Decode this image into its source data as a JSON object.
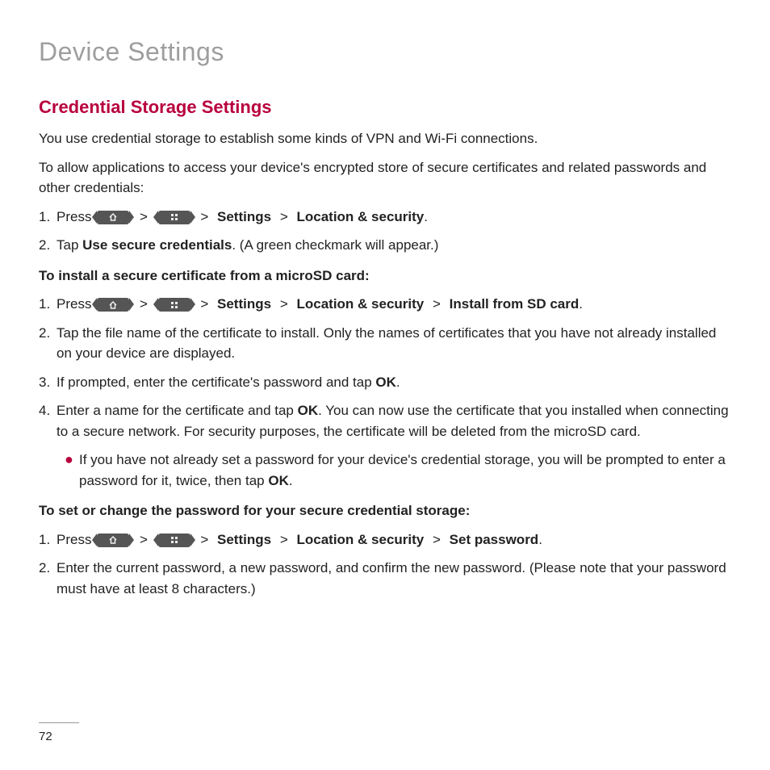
{
  "page_title": "Device Settings",
  "section_title": "Credential Storage Settings",
  "intro1": "You use credential storage to establish some kinds of VPN and Wi-Fi connections.",
  "intro2": "To allow applications to access your device's encrypted store of secure certificates and related passwords and other credentials:",
  "nav": {
    "settings": "Settings",
    "loc_sec": "Location & security",
    "install_sd": "Install from SD card",
    "set_pw": "Set password",
    "gt": ">"
  },
  "step1": {
    "num": "1.",
    "press": "Press",
    "end": "."
  },
  "step2": {
    "num": "2.",
    "pre": "Tap ",
    "bold": "Use secure credentials",
    "post": ". (A green checkmark will appear.)"
  },
  "subA": "To install a secure certificate from a microSD card:",
  "stepA1": {
    "num": "1.",
    "press": "Press",
    "end": "."
  },
  "stepA2": {
    "num": "2.",
    "text": "Tap the file name of the certificate to install. Only the names of certificates that you have not already installed on your device are displayed."
  },
  "stepA3": {
    "num": "3.",
    "pre": "If prompted, enter the certificate's password and tap ",
    "ok": "OK",
    "post": "."
  },
  "stepA4": {
    "num": "4.",
    "pre": "Enter a name for the certificate and tap ",
    "ok": "OK",
    "post": ". You can now use the certificate that you installed when connecting to a secure network. For security purposes, the certificate will be deleted from the microSD card."
  },
  "bulletA": {
    "pre": "If you have not already set a password for your device's credential storage, you will be prompted to enter a password for it, twice, then tap ",
    "ok": "OK",
    "post": "."
  },
  "subB": "To set or change the password for your secure credential storage:",
  "stepB1": {
    "num": "1.",
    "press": "Press",
    "end": "."
  },
  "stepB2": {
    "num": "2.",
    "text": "Enter the current password, a new password, and confirm the new password. (Please note that your password must have at least 8 characters.)"
  },
  "page_number": "72"
}
